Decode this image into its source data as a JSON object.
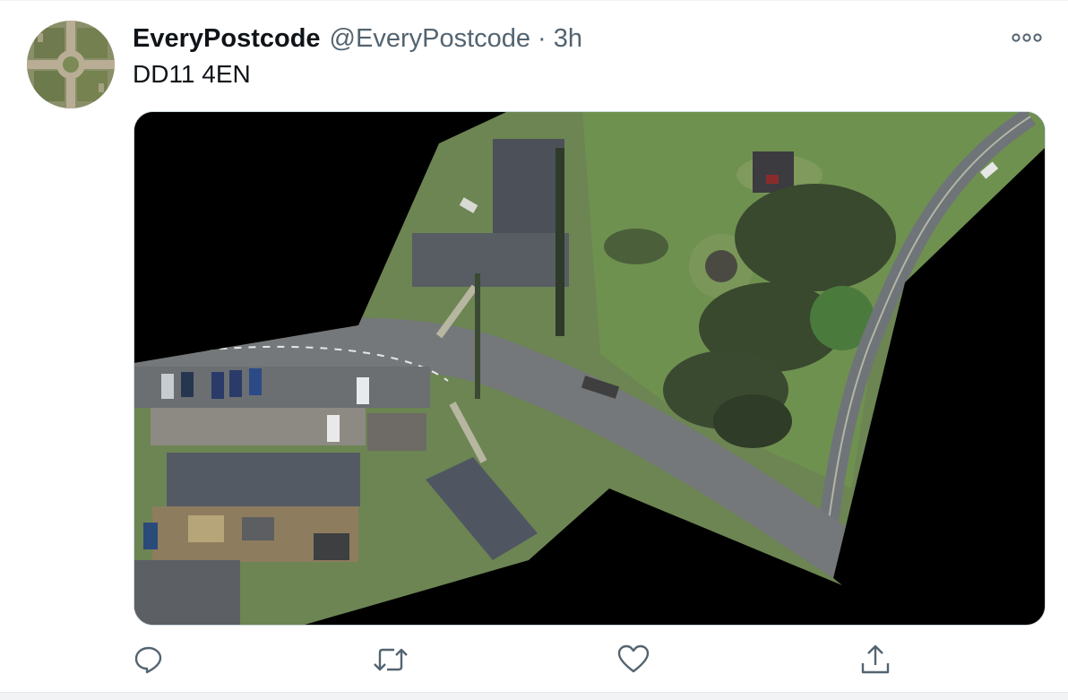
{
  "tweet": {
    "display_name": "EveryPostcode",
    "handle": "@EveryPostcode",
    "separator": "·",
    "time": "3h",
    "text": "DD11 4EN"
  },
  "icons": {
    "more": "more-horizontal-icon",
    "reply": "reply-icon",
    "retweet": "retweet-icon",
    "like": "heart-icon",
    "share": "share-icon"
  },
  "colors": {
    "secondary_text": "#536471",
    "icon": "#536471",
    "border": "#cfd9de"
  }
}
